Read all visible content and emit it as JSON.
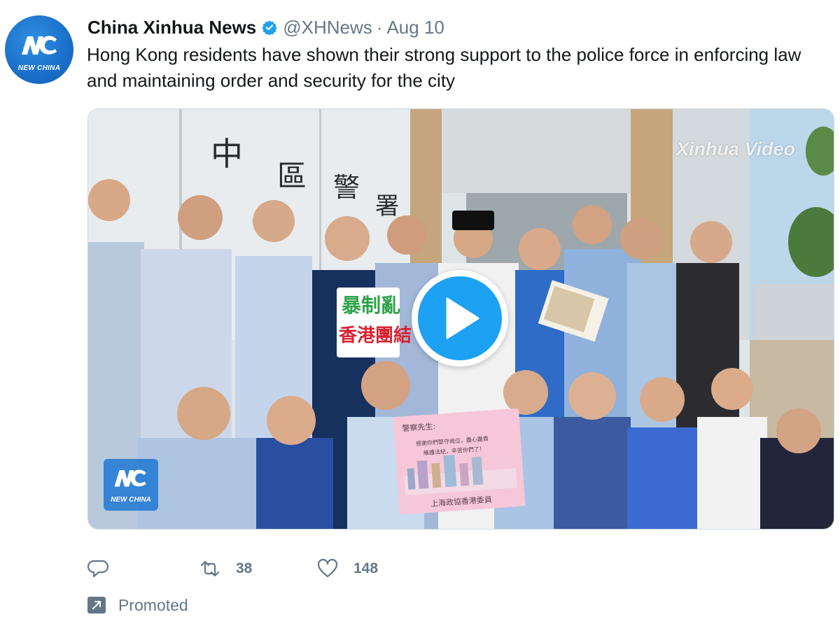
{
  "tweet": {
    "author_name": "China Xinhua News",
    "handle": "@XHNews",
    "separator": "·",
    "date": "Aug 10",
    "text": "Hong Kong residents have shown their strong support to the police force in enforcing law and maintaining order and security for the city",
    "avatar_logo_text": "NEW CHINA",
    "verified": true
  },
  "media": {
    "watermark": "Xinhua Video",
    "corner_logo_text": "NEW CHINA",
    "building_sign": [
      "中",
      "區",
      "警",
      "署"
    ],
    "placard_green": "暴制亂",
    "placard_red": "香港團結",
    "pink_sign_header": "警察先生:",
    "pink_sign_line1": "感謝你們堅守崗位，盡心盡責",
    "pink_sign_line2": "維護法紀，辛苦你們了！",
    "pink_sign_footer": "上海政協香港委員",
    "play_icon": "play-icon"
  },
  "actions": {
    "reply_icon": "reply-icon",
    "retweet_icon": "retweet-icon",
    "retweet_count": "38",
    "like_icon": "heart-icon",
    "like_count": "148"
  },
  "promoted": {
    "label": "Promoted",
    "icon": "promoted-arrow-icon"
  },
  "colors": {
    "brand_blue": "#1da1f2",
    "secondary_text": "#657786",
    "primary_text": "#14171a"
  }
}
